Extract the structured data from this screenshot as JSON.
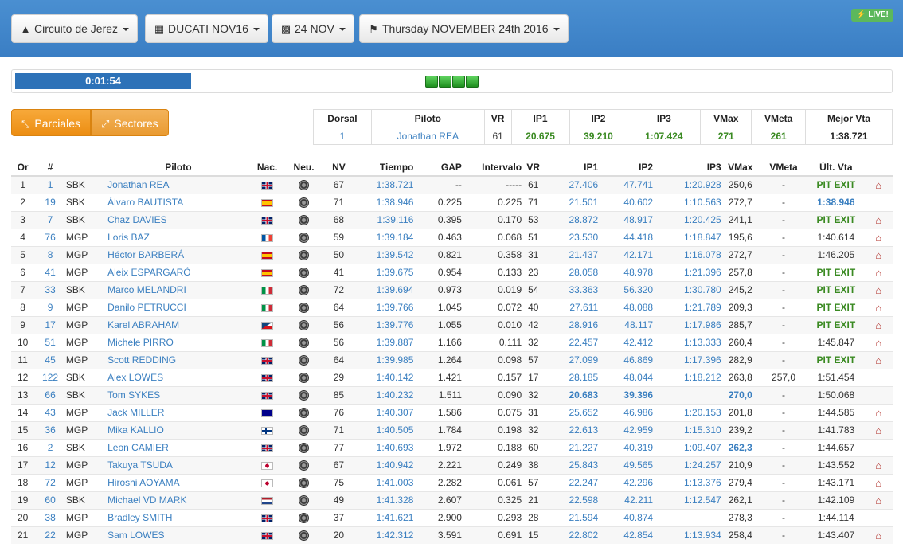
{
  "header": {
    "circuit": "Circuito de Jerez",
    "session": "DUCATI NOV16",
    "date_short": "24 NOV",
    "date_long": "Thursday NOVEMBER 24th 2016",
    "live": "LIVE!",
    "icons": {
      "circuit": "road-icon",
      "session": "calendar-icon",
      "date_short": "bar-chart-icon",
      "date_long": "flag-icon",
      "live": "bolt-icon"
    },
    "colors": {
      "header_bg": "#3d82c8",
      "live_bg": "#5cb85c"
    }
  },
  "progress": {
    "time": "0:01:54",
    "lights_count": 4
  },
  "modes": {
    "parciales": "Parciales",
    "sectores": "Sectores"
  },
  "dorsal_box": {
    "headers": [
      "Dorsal",
      "Piloto",
      "VR",
      "IP1",
      "IP2",
      "IP3",
      "VMax",
      "VMeta",
      "Mejor Vta"
    ],
    "values": [
      "1",
      "Jonathan REA",
      "61",
      "20.675",
      "39.210",
      "1:07.424",
      "271",
      "261",
      "1:38.721"
    ]
  },
  "table": {
    "headers": [
      "Or",
      "#",
      "",
      "Piloto",
      "Nac.",
      "Neu.",
      "NV",
      "Tiempo",
      "GAP",
      "Intervalo",
      "VR",
      "IP1",
      "IP2",
      "IP3",
      "VMax",
      "VMeta",
      "Últ. Vta",
      ""
    ],
    "rows": [
      [
        "1",
        "1",
        "SBK",
        "Jonathan REA",
        "gb",
        "67",
        "1:38.721",
        "--",
        "-----",
        "61",
        "27.406",
        "47.741",
        "1:20.928",
        "250,6",
        "-",
        "PIT EXIT",
        true
      ],
      [
        "2",
        "19",
        "SBK",
        "Álvaro BAUTISTA",
        "es",
        "71",
        "1:38.946",
        "0.225",
        "0.225",
        "71",
        "21.501",
        "40.602",
        "1:10.563",
        "272,7",
        "-",
        "1:38.946",
        false
      ],
      [
        "3",
        "7",
        "SBK",
        "Chaz DAVIES",
        "gb",
        "68",
        "1:39.116",
        "0.395",
        "0.170",
        "53",
        "28.872",
        "48.917",
        "1:20.425",
        "241,1",
        "-",
        "PIT EXIT",
        true
      ],
      [
        "4",
        "76",
        "MGP",
        "Loris BAZ",
        "fr",
        "59",
        "1:39.184",
        "0.463",
        "0.068",
        "51",
        "23.530",
        "44.418",
        "1:18.847",
        "195,6",
        "-",
        "1:40.614",
        true
      ],
      [
        "5",
        "8",
        "MGP",
        "Héctor BARBERÁ",
        "es",
        "50",
        "1:39.542",
        "0.821",
        "0.358",
        "31",
        "21.437",
        "42.171",
        "1:16.078",
        "272,7",
        "-",
        "1:46.205",
        true
      ],
      [
        "6",
        "41",
        "MGP",
        "Aleix ESPARGARÓ",
        "es",
        "41",
        "1:39.675",
        "0.954",
        "0.133",
        "23",
        "28.058",
        "48.978",
        "1:21.396",
        "257,8",
        "-",
        "PIT EXIT",
        true
      ],
      [
        "7",
        "33",
        "SBK",
        "Marco MELANDRI",
        "it",
        "72",
        "1:39.694",
        "0.973",
        "0.019",
        "54",
        "33.363",
        "56.320",
        "1:30.780",
        "245,2",
        "-",
        "PIT EXIT",
        true
      ],
      [
        "8",
        "9",
        "MGP",
        "Danilo PETRUCCI",
        "it",
        "64",
        "1:39.766",
        "1.045",
        "0.072",
        "40",
        "27.611",
        "48.088",
        "1:21.789",
        "209,3",
        "-",
        "PIT EXIT",
        true
      ],
      [
        "9",
        "17",
        "MGP",
        "Karel ABRAHAM",
        "cz",
        "56",
        "1:39.776",
        "1.055",
        "0.010",
        "42",
        "28.916",
        "48.117",
        "1:17.986",
        "285,7",
        "-",
        "PIT EXIT",
        true
      ],
      [
        "10",
        "51",
        "MGP",
        "Michele PIRRO",
        "it",
        "56",
        "1:39.887",
        "1.166",
        "0.111",
        "32",
        "22.457",
        "42.412",
        "1:13.333",
        "260,4",
        "-",
        "1:45.847",
        true
      ],
      [
        "11",
        "45",
        "MGP",
        "Scott REDDING",
        "gb",
        "64",
        "1:39.985",
        "1.264",
        "0.098",
        "57",
        "27.099",
        "46.869",
        "1:17.396",
        "282,9",
        "-",
        "PIT EXIT",
        true
      ],
      [
        "12",
        "122",
        "SBK",
        "Alex LOWES",
        "gb",
        "29",
        "1:40.142",
        "1.421",
        "0.157",
        "17",
        "28.185",
        "48.044",
        "1:18.212",
        "263,8",
        "257,0",
        "1:51.454",
        false
      ],
      [
        "13",
        "66",
        "SBK",
        "Tom SYKES",
        "gb",
        "85",
        "1:40.232",
        "1.511",
        "0.090",
        "32",
        "20.683",
        "39.396",
        "",
        "270,0",
        "-",
        "1:50.068",
        false
      ],
      [
        "14",
        "43",
        "MGP",
        "Jack MILLER",
        "au",
        "76",
        "1:40.307",
        "1.586",
        "0.075",
        "31",
        "25.652",
        "46.986",
        "1:20.153",
        "201,8",
        "-",
        "1:44.585",
        true
      ],
      [
        "15",
        "36",
        "MGP",
        "Mika KALLIO",
        "fi",
        "71",
        "1:40.505",
        "1.784",
        "0.198",
        "32",
        "22.613",
        "42.959",
        "1:15.310",
        "239,2",
        "-",
        "1:41.783",
        true
      ],
      [
        "16",
        "2",
        "SBK",
        "Leon CAMIER",
        "gb",
        "77",
        "1:40.693",
        "1.972",
        "0.188",
        "60",
        "21.227",
        "40.319",
        "1:09.407",
        "262,3",
        "-",
        "1:44.657",
        false
      ],
      [
        "17",
        "12",
        "MGP",
        "Takuya TSUDA",
        "jp",
        "67",
        "1:40.942",
        "2.221",
        "0.249",
        "38",
        "25.843",
        "49.565",
        "1:24.257",
        "210,9",
        "-",
        "1:43.552",
        true
      ],
      [
        "18",
        "72",
        "MGP",
        "Hiroshi AOYAMA",
        "jp",
        "75",
        "1:41.003",
        "2.282",
        "0.061",
        "57",
        "22.247",
        "42.296",
        "1:13.376",
        "279,4",
        "-",
        "1:43.171",
        true
      ],
      [
        "19",
        "60",
        "SBK",
        "Michael VD MARK",
        "nl",
        "49",
        "1:41.328",
        "2.607",
        "0.325",
        "21",
        "22.598",
        "42.211",
        "1:12.547",
        "262,1",
        "-",
        "1:42.109",
        true
      ],
      [
        "20",
        "38",
        "MGP",
        "Bradley SMITH",
        "gb",
        "37",
        "1:41.621",
        "2.900",
        "0.293",
        "28",
        "21.594",
        "40.874",
        "",
        "278,3",
        "-",
        "1:44.114",
        false
      ],
      [
        "21",
        "22",
        "MGP",
        "Sam LOWES",
        "gb",
        "20",
        "1:42.312",
        "3.591",
        "0.691",
        "15",
        "22.802",
        "42.854",
        "1:13.934",
        "258,4",
        "-",
        "1:43.407",
        true
      ]
    ],
    "highlights": {
      "bold_blue_cells": [
        [
          1,
          15
        ],
        [
          12,
          10
        ],
        [
          12,
          11
        ],
        [
          12,
          13
        ],
        [
          15,
          13
        ]
      ]
    }
  }
}
